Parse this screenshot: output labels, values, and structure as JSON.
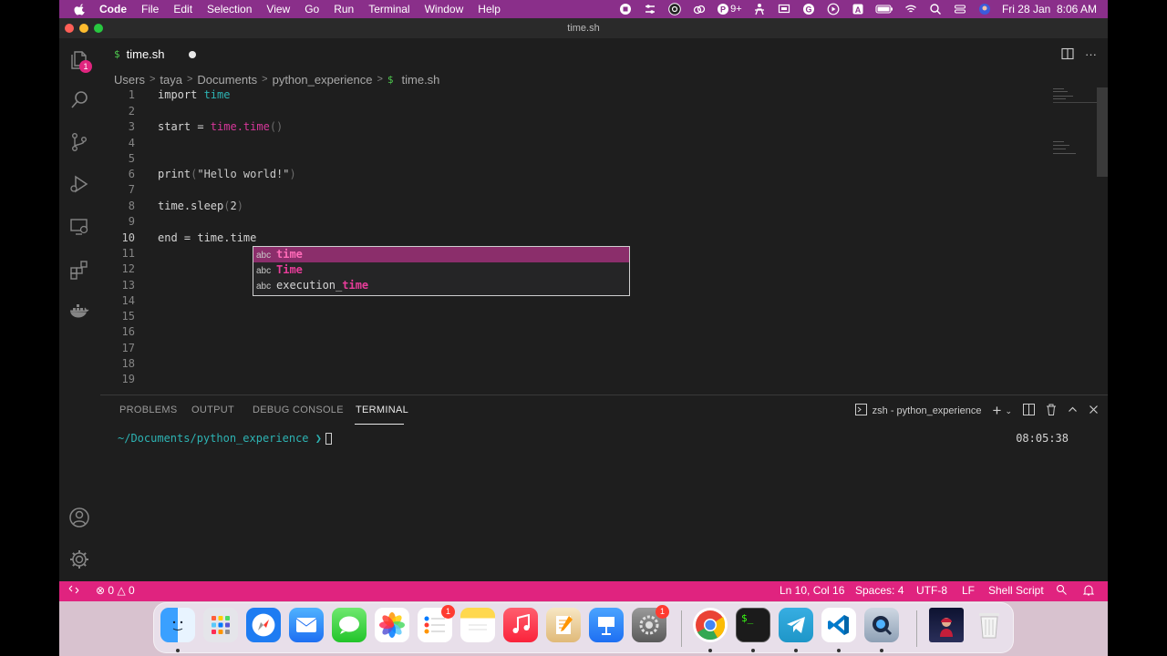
{
  "menubar": {
    "app_name": "Code",
    "items": [
      "File",
      "Edit",
      "Selection",
      "View",
      "Go",
      "Run",
      "Terminal",
      "Window",
      "Help"
    ],
    "p_badge": "9+",
    "datetime": "Fri 28 Jan  8:06 AM"
  },
  "window": {
    "title": "time.sh"
  },
  "activity": {
    "explorer_badge": "1"
  },
  "tab": {
    "label": "time.sh",
    "icon_glyph": "$"
  },
  "breadcrumb": [
    "Users",
    "taya",
    "Documents",
    "python_experience",
    "time.sh"
  ],
  "editor": {
    "active_line": 10,
    "line_numbers": [
      "1",
      "2",
      "3",
      "4",
      "5",
      "6",
      "7",
      "8",
      "9",
      "10",
      "11",
      "12",
      "13",
      "14",
      "15",
      "16",
      "17",
      "18",
      "19"
    ],
    "code": {
      "l1_kw": "import ",
      "l1_mod": "time",
      "l3_a": "start = ",
      "l3_b": "time.time",
      "l3_c": "()",
      "l6_a": "print",
      "l6_b": "(",
      "l6_c": "\"Hello world!\"",
      "l6_d": ")",
      "l8_a": "time.sleep",
      "l8_b": "(",
      "l8_c": "2",
      "l8_d": ")",
      "l10": "end = time.time"
    }
  },
  "suggest": {
    "kind": "abc",
    "items": [
      {
        "prefix": "",
        "match": "time",
        "selected": true
      },
      {
        "prefix": "",
        "match": "Time",
        "selected": false
      },
      {
        "prefix": "execution_",
        "match": "time",
        "selected": false
      }
    ]
  },
  "panel": {
    "tabs": [
      "PROBLEMS",
      "OUTPUT",
      "DEBUG CONSOLE",
      "TERMINAL"
    ],
    "active_tab": "TERMINAL",
    "terminal_name": "zsh - python_experience",
    "prompt": "~/Documents/python_experience ❯",
    "time": "08:05:38"
  },
  "statusbar": {
    "errors": "0",
    "warnings": "0",
    "position": "Ln 10, Col 16",
    "spaces": "Spaces: 4",
    "encoding": "UTF-8",
    "eol": "LF",
    "language": "Shell Script"
  },
  "dock": {
    "reminders_badge": "1",
    "settings_badge": "1"
  },
  "colors": {
    "accent": "#e0237f",
    "menubar": "#8a2f8a",
    "editor_bg": "#1e1e1e",
    "suggest_selected": "#8b2e6b"
  }
}
